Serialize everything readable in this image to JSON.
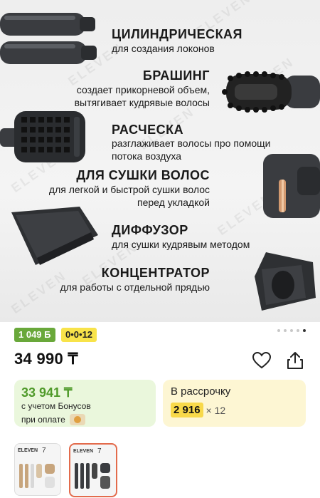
{
  "hero": {
    "watermark": "ELEVEN",
    "items": [
      {
        "title": "ЦИЛИНДРИЧЕСКАЯ",
        "lines": [
          "для создания локонов"
        ]
      },
      {
        "title": "БРАШИНГ",
        "lines": [
          "создает прикорневой объем,",
          "вытягивает кудрявые волосы"
        ]
      },
      {
        "title": "РАСЧЕСКА",
        "lines": [
          "разглаживает волосы про помощи",
          "потока воздуха"
        ]
      },
      {
        "title": "ДЛЯ СУШКИ ВОЛОС",
        "lines": [
          "для легкой и быстрой сушки волос",
          "перед укладкой"
        ]
      },
      {
        "title": "ДИФФУЗОР",
        "lines": [
          "для сушки кудрявым методом"
        ]
      },
      {
        "title": "КОНЦЕНТРАТОР",
        "lines": [
          "для работы с отдельной прядью"
        ]
      }
    ],
    "pager_count": 6,
    "pager_active": 5
  },
  "badges": {
    "bonus": "1 049 Б",
    "installment": "0•0•12"
  },
  "product": {
    "price": "34 990 ₸"
  },
  "bonus_card": {
    "price": "33 941 ₸",
    "line1": "с учетом Бонусов",
    "line2": "при оплате"
  },
  "installment_card": {
    "title": "В рассрочку",
    "amount": "2 916",
    "times": "× 12"
  },
  "thumbnails": [
    {
      "brand": "ELEVEN",
      "model": "7"
    },
    {
      "brand": "ELEVEN",
      "model": "7"
    }
  ],
  "colors": {
    "bonus_green": "#69a83a",
    "card_green": "#eaf7dc",
    "card_yellow": "#fdf6d3",
    "amount_yellow": "#f8d94a",
    "selected_border": "#e36b4c"
  }
}
